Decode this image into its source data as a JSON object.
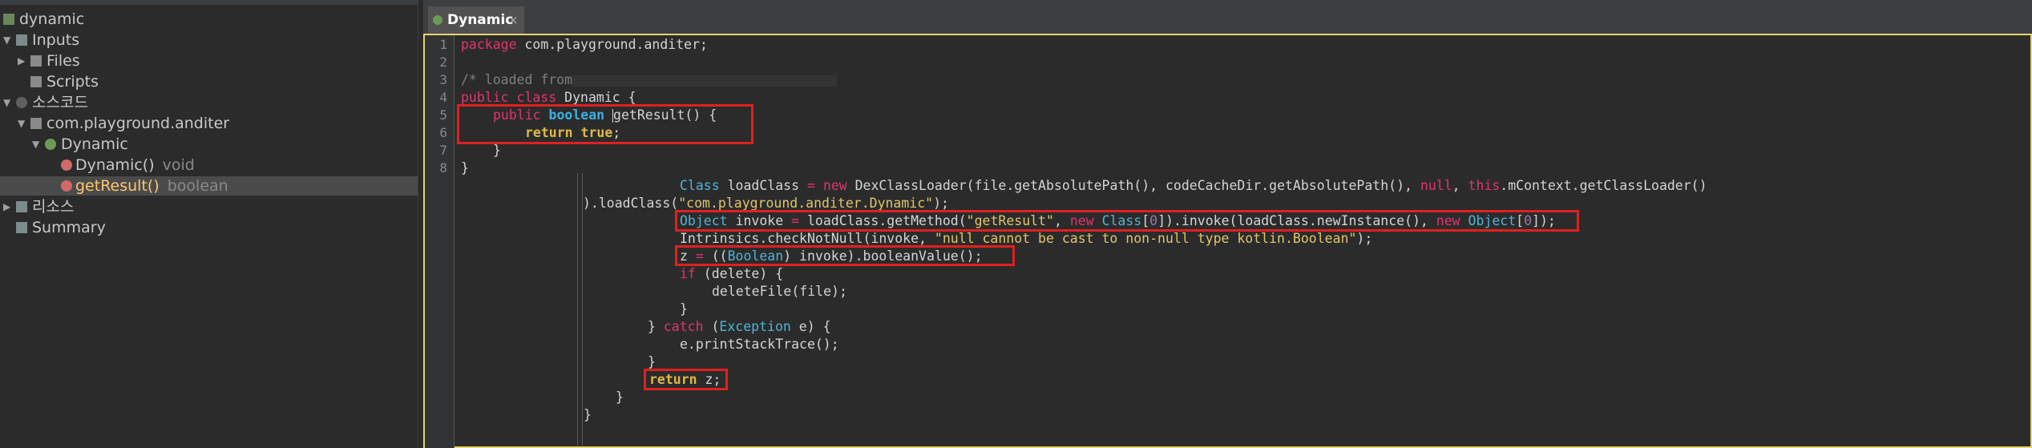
{
  "tree": {
    "root": "dynamic",
    "inputs": "Inputs",
    "files": "Files",
    "scripts": "Scripts",
    "source": "소스코드",
    "package": "com.playground.anditer",
    "class": "Dynamic",
    "method_ctor": "Dynamic()",
    "method_ctor_type": "void",
    "method_sel": "getResult()",
    "method_sel_type": "boolean",
    "resources": "리소스",
    "summary": "Summary"
  },
  "editor": {
    "tab_title": "Dynamic",
    "tab_close": "×",
    "line_numbers": [
      "1",
      "2",
      "3",
      "4",
      "5",
      "6",
      "7",
      "8"
    ],
    "code": {
      "l1_kw": "package",
      "l1_rest": " com.playground.anditer;",
      "l3": "/* loaded from",
      "l4_kw": "public class",
      "l4_rest": " Dynamic {",
      "l5_kw": "public",
      "l5_type": "boolean",
      "l5_rest": "getResult() {",
      "l6_kw": "return",
      "l6_val": "true",
      "l6_end": ";",
      "l7": "}",
      "l8": "}",
      "b1_type": "Class",
      "b1_a": " loadClass ",
      "b1_eq": "=",
      "b1_new": "new",
      "b1_b": " DexClassLoader(file.getAbsolutePath(), codeCacheDir.getAbsolutePath(), ",
      "b1_null": "null",
      "b1_c": ", ",
      "b1_this": "this",
      "b1_d": ".mContext.getClassLoader()",
      "b2_a": ").loadClass(",
      "b2_str": "\"com.playground.anditer.Dynamic\"",
      "b2_b": ");",
      "b3_type": "Object",
      "b3_a": " invoke ",
      "b3_eq": "=",
      "b3_b": " loadClass.getMethod(",
      "b3_str": "\"getResult\"",
      "b3_c": ", ",
      "b3_new": "new",
      "b3_type2": "Class",
      "b3_d": "[",
      "b3_n1": "0",
      "b3_e": "]).invoke(loadClass.newInstance(), ",
      "b3_new2": "new",
      "b3_type3": "Object",
      "b3_f": "[",
      "b3_n2": "0",
      "b3_g": "]);",
      "b4_a": "Intrinsics.checkNotNull(invoke, ",
      "b4_str": "\"null cannot be cast to non-null type kotlin.Boolean\"",
      "b4_b": ");",
      "b5_a": "z ",
      "b5_eq": "=",
      "b5_b": " ((",
      "b5_type": "Boolean",
      "b5_c": ") invoke).booleanValue();",
      "b6_kw": "if",
      "b6_rest": " (delete) {",
      "b7": "deleteFile(file);",
      "b8": "}",
      "b9_a": "} ",
      "b9_kw": "catch",
      "b9_b": " (",
      "b9_type": "Exception",
      "b9_c": " e) {",
      "b10": "e.printStackTrace();",
      "b11": "}",
      "b12_kw": "return",
      "b12_rest": " z;",
      "b13": "}",
      "b14": "}"
    }
  },
  "colors": {
    "keyword": "#e0356b",
    "keyword_bold": "#e0b845",
    "type": "#4fb3d9",
    "string": "#e2c56a",
    "highlight_box": "#e02020",
    "tab_accent": "#e8c46a",
    "selection_text": "#ffc66d"
  },
  "icons": [
    "tree-grid-icon",
    "folder-icon",
    "script-icon",
    "package-icon",
    "class-icon",
    "method-icon",
    "summary-icon",
    "tab-class-icon"
  ]
}
